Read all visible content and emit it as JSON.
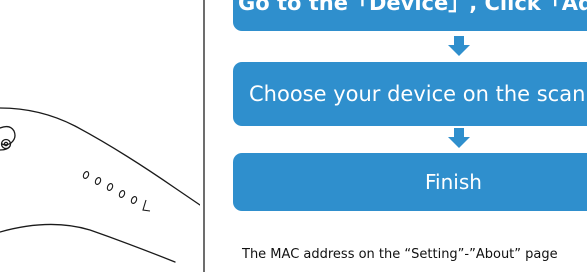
{
  "band": {
    "digits": "0 0 0 0 0 L"
  },
  "steps": [
    {
      "label": "Go to the「Device」, Click「Add d"
    },
    {
      "label": "Choose your device on the scanning"
    },
    {
      "label": "Finish"
    }
  ],
  "note": {
    "text": "The MAC address on the “Setting”-”About” page"
  },
  "colors": {
    "step_box": "#2f8fcd",
    "divider": "#6d6d6d",
    "line_art": "#1a1a1a"
  },
  "icons": [
    "down-arrow-icon",
    "down-arrow-icon"
  ]
}
